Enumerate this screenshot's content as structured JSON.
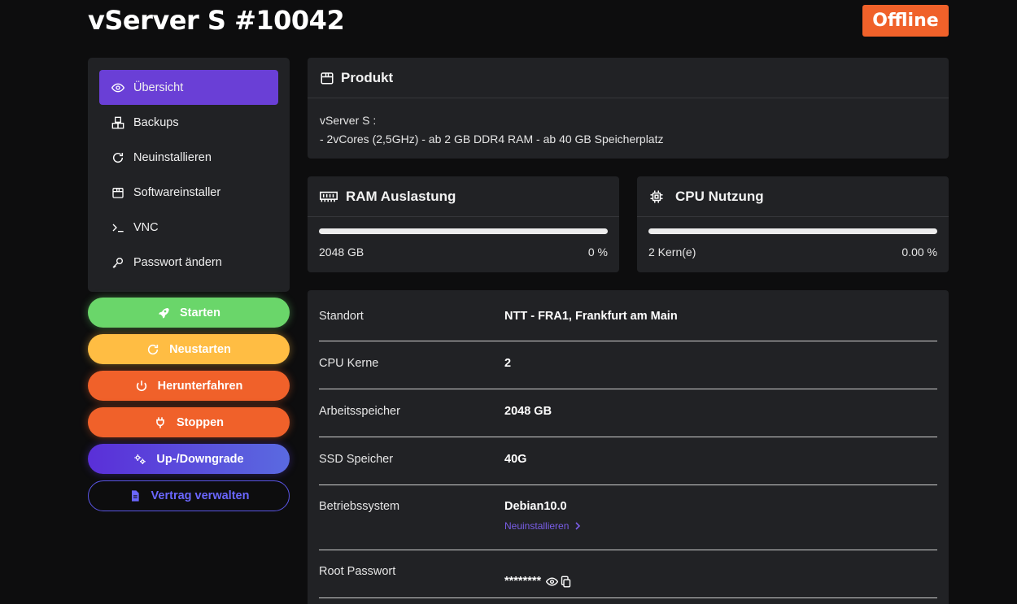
{
  "header": {
    "title": "vServer S #10042",
    "status": "Offline"
  },
  "colors": {
    "accent": "#6a3fd6",
    "offline": "#f0612a",
    "start": "#6ad66a",
    "restart": "#ffbd43",
    "upgrade": "#5a2fd8",
    "contract": "#5a55e6"
  },
  "sidebar": {
    "items": [
      {
        "label": "Übersicht",
        "icon": "eye-icon",
        "active": true
      },
      {
        "label": "Backups",
        "icon": "boxes-icon"
      },
      {
        "label": "Neuinstallieren",
        "icon": "refresh-icon"
      },
      {
        "label": "Softwareinstaller",
        "icon": "box-icon"
      },
      {
        "label": "VNC",
        "icon": "terminal-icon"
      },
      {
        "label": "Passwort ändern",
        "icon": "key-icon"
      }
    ]
  },
  "actions": {
    "start": "Starten",
    "restart": "Neustarten",
    "shutdown": "Herunterfahren",
    "stop": "Stoppen",
    "upgrade": "Up-/Downgrade",
    "contract": "Vertrag verwalten"
  },
  "product": {
    "title": "Produkt",
    "line1": "vServer S :",
    "line2": "- 2vCores (2,5GHz) - ab 2 GB DDR4 RAM - ab 40 GB Speicherplatz"
  },
  "ram": {
    "title": "RAM Auslastung",
    "total": "2048 GB",
    "percent": "0 %",
    "usage_fraction": 0
  },
  "cpu": {
    "title": "CPU Nutzung",
    "cores": "2 Kern(e)",
    "percent": "0.00 %",
    "usage_fraction": 0
  },
  "info": {
    "location_label": "Standort",
    "location_value": "NTT - FRA1, Frankfurt am Main",
    "cores_label": "CPU Kerne",
    "cores_value": "2",
    "memory_label": "Arbeitsspeicher",
    "memory_value": "2048 GB",
    "ssd_label": "SSD Speicher",
    "ssd_value": "40G",
    "os_label": "Betriebssystem",
    "os_value": "Debian10.0",
    "os_reinstall": "Neuinstallieren",
    "root_label": "Root Passwort",
    "root_value": "********"
  }
}
